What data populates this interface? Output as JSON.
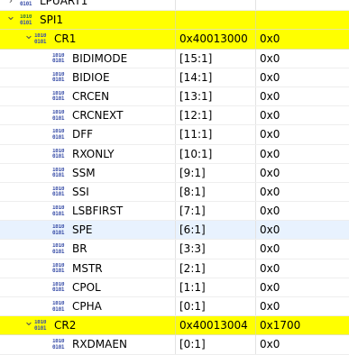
{
  "tree": [
    {
      "name": "LPUART1",
      "address": "",
      "value": "",
      "level": 0,
      "kind": "peripheral",
      "expanded": false,
      "highlight": false
    },
    {
      "name": "SPI1",
      "address": "",
      "value": "",
      "level": 0,
      "kind": "peripheral",
      "expanded": true,
      "highlight": true
    },
    {
      "name": "CR1",
      "address": "0x40013000",
      "value": "0x0",
      "level": 1,
      "kind": "register",
      "expanded": true,
      "highlight": true
    },
    {
      "name": "BIDIMODE",
      "address": "[15:1]",
      "value": "0x0",
      "level": 2,
      "kind": "field"
    },
    {
      "name": "BIDIOE",
      "address": "[14:1]",
      "value": "0x0",
      "level": 2,
      "kind": "field"
    },
    {
      "name": "CRCEN",
      "address": "[13:1]",
      "value": "0x0",
      "level": 2,
      "kind": "field"
    },
    {
      "name": "CRCNEXT",
      "address": "[12:1]",
      "value": "0x0",
      "level": 2,
      "kind": "field"
    },
    {
      "name": "DFF",
      "address": "[11:1]",
      "value": "0x0",
      "level": 2,
      "kind": "field"
    },
    {
      "name": "RXONLY",
      "address": "[10:1]",
      "value": "0x0",
      "level": 2,
      "kind": "field"
    },
    {
      "name": "SSM",
      "address": "[9:1]",
      "value": "0x0",
      "level": 2,
      "kind": "field"
    },
    {
      "name": "SSI",
      "address": "[8:1]",
      "value": "0x0",
      "level": 2,
      "kind": "field"
    },
    {
      "name": "LSBFIRST",
      "address": "[7:1]",
      "value": "0x0",
      "level": 2,
      "kind": "field"
    },
    {
      "name": "SPE",
      "address": "[6:1]",
      "value": "0x0",
      "level": 2,
      "kind": "field",
      "selected": true
    },
    {
      "name": "BR",
      "address": "[3:3]",
      "value": "0x0",
      "level": 2,
      "kind": "field"
    },
    {
      "name": "MSTR",
      "address": "[2:1]",
      "value": "0x0",
      "level": 2,
      "kind": "field"
    },
    {
      "name": "CPOL",
      "address": "[1:1]",
      "value": "0x0",
      "level": 2,
      "kind": "field"
    },
    {
      "name": "CPHA",
      "address": "[0:1]",
      "value": "0x0",
      "level": 2,
      "kind": "field"
    },
    {
      "name": "CR2",
      "address": "0x40013004",
      "value": "0x1700",
      "level": 1,
      "kind": "register",
      "expanded": true,
      "highlight": true
    },
    {
      "name": "RXDMAEN",
      "address": "[0:1]",
      "value": "0x0",
      "level": 2,
      "kind": "field"
    }
  ],
  "icons": {
    "register": "register-icon",
    "field": "field-icon",
    "peripheral": "peripheral-icon"
  },
  "icon_glyph": {
    "line1": "1010",
    "line2": "0101"
  },
  "colors": {
    "highlight": "#ffff00",
    "selected": "#e8f2fe",
    "icon": "#3a4fa8"
  }
}
